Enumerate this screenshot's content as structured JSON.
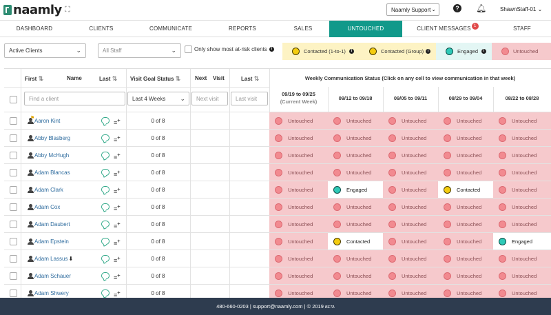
{
  "brand": {
    "name": "naamly"
  },
  "topbar": {
    "support_select": "Naamly Support",
    "user": "ShawnStaff-01",
    "help_glyph": "?"
  },
  "nav": {
    "items": [
      {
        "label": "DASHBOARD"
      },
      {
        "label": "CLIENTS"
      },
      {
        "label": "COMMUNICATE"
      },
      {
        "label": "REPORTS"
      },
      {
        "label": "SALES"
      },
      {
        "label": "UNTOUCHED",
        "active": true
      },
      {
        "label": "CLIENT MESSAGES",
        "badge": "1"
      },
      {
        "label": "STAFF"
      }
    ]
  },
  "filters": {
    "client_status": "Active Clients",
    "staff": "All Staff",
    "at_risk_label": "Only show most at-risk clients"
  },
  "legend": [
    {
      "label": "Contacted (1-to-1)",
      "color": "#fdf3c4",
      "dot": "yellow"
    },
    {
      "label": "Contacted (Group)",
      "color": "#fdf3c4",
      "dot": "yellow"
    },
    {
      "label": "Engaged",
      "color": "#e3f6f4",
      "dot": "teal"
    },
    {
      "label": "Untouched",
      "color": "#f6c9cc",
      "dot": "pink"
    }
  ],
  "table": {
    "headers": {
      "first": "First",
      "name": "Name",
      "last": "Last",
      "visit_goal": "Visit Goal Status",
      "next": "Next",
      "visit": "Visit",
      "last_visit": "Last",
      "weekly": "Weekly Communication Status (Click on any cell to view communication in that week)"
    },
    "filter_inputs": {
      "client_placeholder": "Find a client",
      "goal_period": "Last 4 Weeks",
      "next_visit_placeholder": "Next visit",
      "last_visit_placeholder": "Last visit"
    },
    "weeks": [
      {
        "label": "09/19 to 09/25",
        "sub": "(Current Week)"
      },
      {
        "label": "09/12 to 09/18",
        "sub": ""
      },
      {
        "label": "09/05 to 09/11",
        "sub": ""
      },
      {
        "label": "08/29 to 09/04",
        "sub": ""
      },
      {
        "label": "08/22 to 08/28",
        "sub": ""
      }
    ],
    "rows": [
      {
        "name": "Aaron Kint",
        "flag": true,
        "goal": "0 of 8",
        "weeks": [
          "Untouched",
          "Untouched",
          "Untouched",
          "Untouched",
          "Untouched"
        ]
      },
      {
        "name": "Abby Blasberg",
        "goal": "0 of 8",
        "weeks": [
          "Untouched",
          "Untouched",
          "Untouched",
          "Untouched",
          "Untouched"
        ]
      },
      {
        "name": "Abby McHugh",
        "goal": "0 of 8",
        "weeks": [
          "Untouched",
          "Untouched",
          "Untouched",
          "Untouched",
          "Untouched"
        ]
      },
      {
        "name": "Adam Blancas",
        "goal": "0 of 8",
        "weeks": [
          "Untouched",
          "Untouched",
          "Untouched",
          "Untouched",
          "Untouched"
        ]
      },
      {
        "name": "Adam Clark",
        "goal": "0 of 8",
        "weeks": [
          "Untouched",
          "Engaged",
          "Untouched",
          "Contacted",
          "Untouched"
        ]
      },
      {
        "name": "Adam Cox",
        "goal": "0 of 8",
        "weeks": [
          "Untouched",
          "Untouched",
          "Untouched",
          "Untouched",
          "Untouched"
        ]
      },
      {
        "name": "Adam Daubert",
        "goal": "0 of 8",
        "weeks": [
          "Untouched",
          "Untouched",
          "Untouched",
          "Untouched",
          "Untouched"
        ]
      },
      {
        "name": "Adam Epstein",
        "goal": "0 of 8",
        "weeks": [
          "Untouched",
          "Contacted",
          "Untouched",
          "Untouched",
          "Engaged"
        ]
      },
      {
        "name": "Adam Lassus",
        "download": true,
        "goal": "0 of 8",
        "weeks": [
          "Untouched",
          "Untouched",
          "Untouched",
          "Untouched",
          "Untouched"
        ]
      },
      {
        "name": "Adam Schauer",
        "goal": "0 of 8",
        "weeks": [
          "Untouched",
          "Untouched",
          "Untouched",
          "Untouched",
          "Untouched"
        ]
      },
      {
        "name": "Adam Shwery",
        "goal": "0 of 8",
        "weeks": [
          "Untouched",
          "Untouched",
          "Untouched",
          "Untouched",
          "Untouched"
        ]
      }
    ]
  },
  "footer": {
    "text": "480-660-0203 | support@naamly.com | © 2019",
    "beta": "BETA"
  }
}
